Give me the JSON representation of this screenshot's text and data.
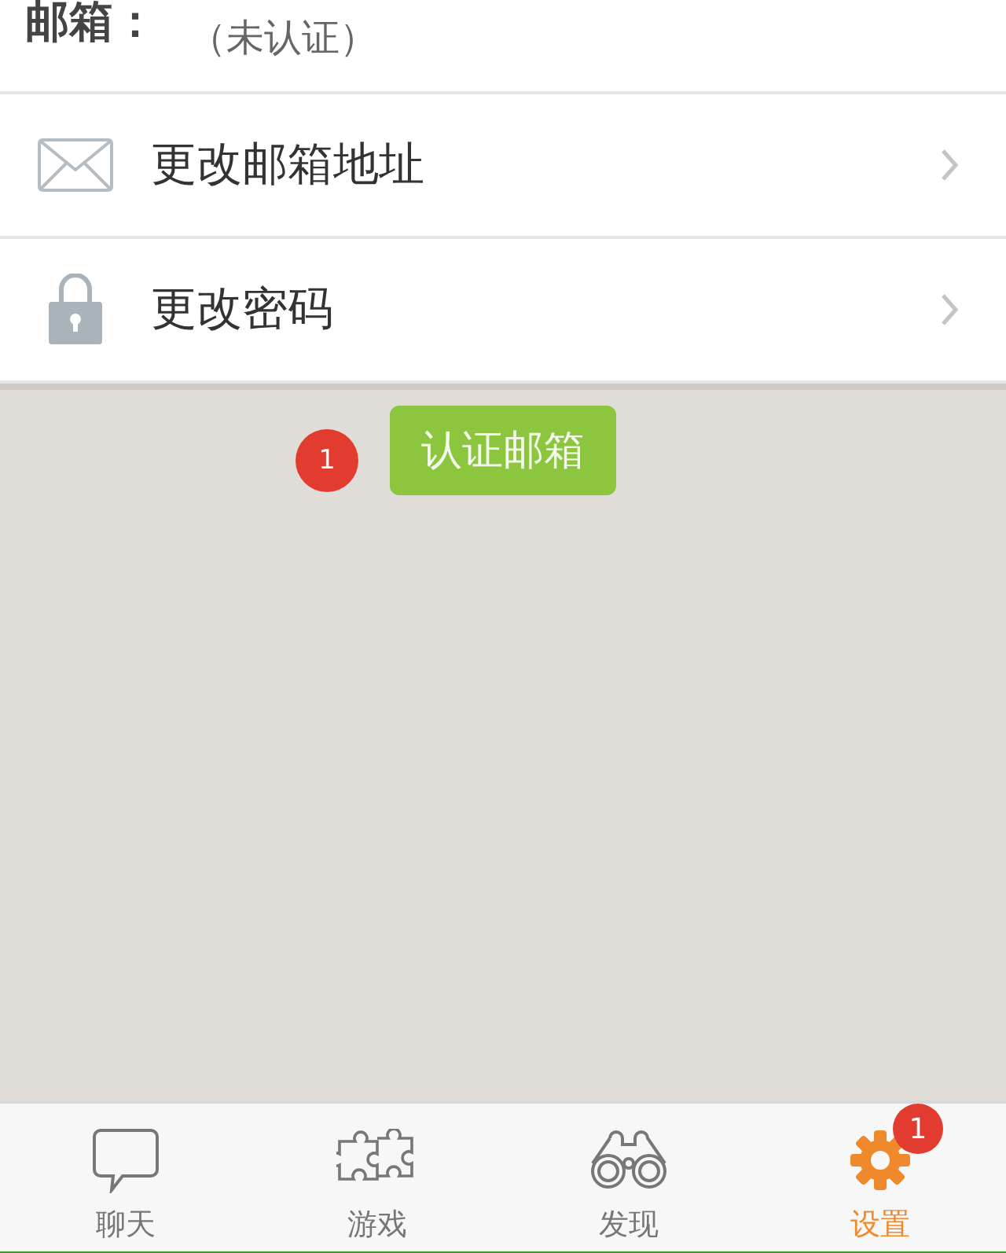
{
  "email_row": {
    "label": "邮箱：",
    "status": "（未认证）"
  },
  "menu": [
    {
      "kind": "mail",
      "label": "更改邮箱地址"
    },
    {
      "kind": "lock",
      "label": "更改密码"
    }
  ],
  "verify": {
    "badge": "1",
    "button": "认证邮箱"
  },
  "tabs": [
    {
      "kind": "chat",
      "label": "聊天",
      "selected": false
    },
    {
      "kind": "puzzle",
      "label": "游戏",
      "selected": false
    },
    {
      "kind": "binoculars",
      "label": "发现",
      "selected": false
    },
    {
      "kind": "gear",
      "label": "设置",
      "selected": true,
      "badge": "1"
    }
  ]
}
